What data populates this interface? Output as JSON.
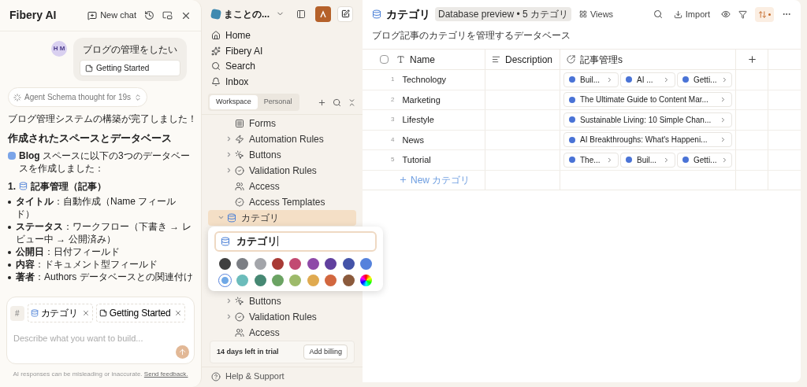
{
  "chat": {
    "title": "Fibery AI",
    "new_chat": "New chat",
    "user_message": {
      "avatar": "H M",
      "text": "ブログの管理をしたい",
      "attachment": "Getting Started"
    },
    "thought": "Agent Schema thought for 19s",
    "intro": "ブログ管理システムの構築が完了しました！",
    "heading": "作成されたスペースとデータベース",
    "space_line": {
      "space": "Blog",
      "text": "スペースに以下の3つのデータベースを作成しました："
    },
    "section": {
      "number": "1.",
      "title": "記事管理（記事）"
    },
    "bullets": [
      "**タイトル**：自動作成（Name フィールド）",
      "**ステータス**：ワークフロー（下書き → レビュー中 → 公開済み）",
      "**公開日**：日付フィールド",
      "**内容**：ドキュメント型フィールド",
      "**著者**：Authors データベースとの関連付け"
    ],
    "composer": {
      "hash": "#",
      "chips": [
        {
          "kind": "database",
          "label": "カテゴリ"
        },
        {
          "kind": "document",
          "label": "Getting Started"
        }
      ],
      "placeholder": "Describe what you want to build..."
    },
    "disclaimer": "AI responses can be misleading or inaccurate.",
    "feedback": "Send feedback."
  },
  "sidebar": {
    "workspace": "まことの...",
    "nav": [
      {
        "kind": "home",
        "label": "Home"
      },
      {
        "kind": "ai",
        "label": "Fibery AI"
      },
      {
        "kind": "search",
        "label": "Search"
      },
      {
        "kind": "inbox",
        "label": "Inbox"
      }
    ],
    "tabs": [
      {
        "label": "Workspace",
        "selected": true
      },
      {
        "label": "Personal",
        "selected": false
      }
    ],
    "tree": [
      {
        "children": [
          {
            "kind": "form",
            "label": "Forms"
          },
          {
            "kind": "automation",
            "label": "Automation Rules",
            "expanded": false
          },
          {
            "kind": "button",
            "label": "Buttons",
            "expanded": false
          },
          {
            "kind": "validation",
            "label": "Validation Rules",
            "expanded": false
          },
          {
            "kind": "access",
            "label": "Access"
          },
          {
            "kind": "template",
            "label": "Access Templates"
          }
        ]
      },
      {
        "kind": "database",
        "label": "カテゴリ",
        "expanded": true,
        "selected": true,
        "children": [
          {
            "kind": "button",
            "label": "Buttons",
            "expanded": false
          },
          {
            "kind": "validation",
            "label": "Validation Rules",
            "expanded": false
          },
          {
            "kind": "access",
            "label": "Access"
          }
        ]
      }
    ],
    "trial": "14 days left in trial",
    "billing": "Add billing",
    "help": "Help & Support"
  },
  "rename_popover": {
    "value": "カテゴリ",
    "swatches": [
      {
        "kind": "solid",
        "color": "#3f3f3f",
        "selected": false
      },
      {
        "kind": "solid",
        "color": "#7b7e84",
        "selected": false
      },
      {
        "kind": "solid",
        "color": "#a3a5aa",
        "selected": false
      },
      {
        "kind": "solid",
        "color": "#a83a35",
        "selected": false
      },
      {
        "kind": "solid",
        "color": "#c24a72",
        "selected": false
      },
      {
        "kind": "solid",
        "color": "#8e4aa8",
        "selected": false
      },
      {
        "kind": "solid",
        "color": "#61409e",
        "selected": false
      },
      {
        "kind": "solid",
        "color": "#4453a8",
        "selected": false
      },
      {
        "kind": "solid",
        "color": "#5582dc",
        "selected": false
      },
      {
        "kind": "solid",
        "color": "#6fa8e6",
        "selected": true
      },
      {
        "kind": "solid",
        "color": "#6bbcbb",
        "selected": false
      },
      {
        "kind": "solid",
        "color": "#468873",
        "selected": false
      },
      {
        "kind": "solid",
        "color": "#6ba363",
        "selected": false
      },
      {
        "kind": "solid",
        "color": "#9dba6a",
        "selected": false
      },
      {
        "kind": "solid",
        "color": "#e0aa50",
        "selected": false
      },
      {
        "kind": "solid",
        "color": "#d2673f",
        "selected": false
      },
      {
        "kind": "solid",
        "color": "#8b5a3c",
        "selected": false
      },
      {
        "kind": "spectrum",
        "selected": false
      }
    ]
  },
  "database": {
    "title": "カテゴリ",
    "badge": "Database preview • 5 カテゴリ",
    "views": "Views",
    "import": "Import",
    "description": "ブログ記事のカテゴリを管理するデータベース",
    "select_all": {
      "checked": false
    },
    "columns": [
      {
        "kind": "text",
        "label": "Name"
      },
      {
        "kind": "rich",
        "label": "Description"
      },
      {
        "kind": "relation",
        "label": "記事管理s"
      }
    ],
    "rows": [
      {
        "number": "1",
        "name": "Technology",
        "links": [
          "Buil...",
          "AI ...",
          "Getti..."
        ]
      },
      {
        "number": "2",
        "name": "Marketing",
        "links": [
          "The Ultimate Guide to Content Mar..."
        ]
      },
      {
        "number": "3",
        "name": "Lifestyle",
        "links": [
          "Sustainable Living: 10 Simple Chan..."
        ]
      },
      {
        "number": "4",
        "name": "News",
        "links": [
          "AI Breakthroughs: What's Happeni..."
        ]
      },
      {
        "number": "5",
        "name": "Tutorial",
        "links": [
          "The...",
          "Buil...",
          "Getti..."
        ]
      }
    ],
    "new_row": "New カテゴリ"
  }
}
